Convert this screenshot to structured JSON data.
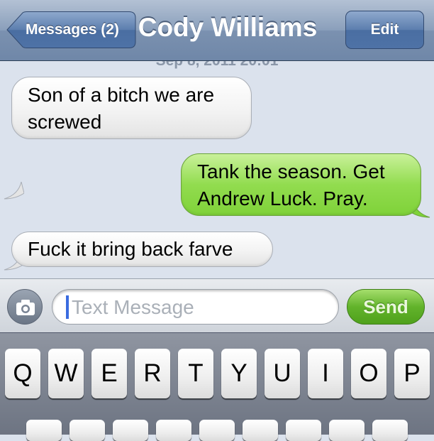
{
  "navbar": {
    "back_label": "Messages (2)",
    "title": "Cody Williams",
    "edit_label": "Edit"
  },
  "timestamp": "Sep 8, 2011 20:01",
  "messages": [
    {
      "from": "contact",
      "lines": [
        "Son of a bitch we are",
        "screwed"
      ]
    },
    {
      "from": "me",
      "lines": [
        "Tank the season. Get",
        "Andrew Luck. Pray."
      ]
    },
    {
      "from": "contact",
      "lines": [
        "Fuck it bring back farve"
      ]
    }
  ],
  "compose": {
    "placeholder": "Text Message",
    "value": "",
    "send_label": "Send",
    "camera_icon": "camera-icon"
  },
  "keyboard": {
    "row1": [
      "Q",
      "W",
      "E",
      "R",
      "T",
      "Y",
      "U",
      "I",
      "O",
      "P"
    ]
  },
  "colors": {
    "outgoing_bubble": "#92dc4f",
    "incoming_bubble": "#f3f3f3",
    "navbar": "#8a9fbb",
    "send_button": "#62b32b"
  }
}
